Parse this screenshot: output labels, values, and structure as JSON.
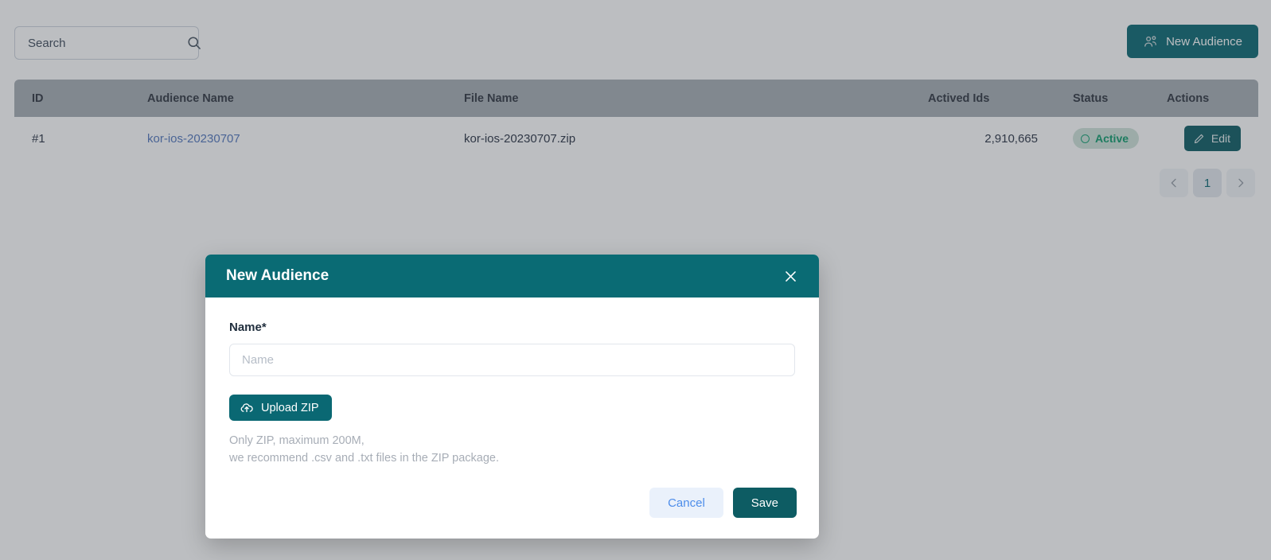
{
  "toolbar": {
    "search_placeholder": "Search",
    "search_value": "",
    "search_icon": "search-icon",
    "new_audience_label": "New Audience",
    "new_audience_icon": "users-group-icon"
  },
  "table": {
    "columns": [
      {
        "key": "id",
        "label": "ID",
        "align": "left"
      },
      {
        "key": "audience_name",
        "label": "Audience Name",
        "align": "left"
      },
      {
        "key": "file_name",
        "label": "File Name",
        "align": "left"
      },
      {
        "key": "actived_ids",
        "label": "Actived Ids",
        "align": "right"
      },
      {
        "key": "status",
        "label": "Status",
        "align": "left"
      },
      {
        "key": "actions",
        "label": "Actions",
        "align": "right"
      }
    ],
    "rows": [
      {
        "id": "#1",
        "audience_name": "kor-ios-20230707",
        "file_name": "kor-ios-20230707.zip",
        "actived_ids": "2,910,665",
        "status": "Active",
        "status_icon": "circle-outline-icon",
        "action_label": "Edit",
        "action_icon": "pencil-icon"
      }
    ]
  },
  "pagination": {
    "prev_icon": "chevron-left-icon",
    "next_icon": "chevron-right-icon",
    "current_page": "1"
  },
  "modal": {
    "title": "New Audience",
    "close_icon": "close-icon",
    "name_label": "Name*",
    "name_placeholder": "Name",
    "name_value": "",
    "upload_label": "Upload ZIP",
    "upload_icon": "cloud-upload-icon",
    "hint_line_1": "Only ZIP, maximum 200M,",
    "hint_line_2": "we recommend .csv and .txt files in the ZIP package.",
    "cancel_label": "Cancel",
    "save_label": "Save"
  },
  "colors": {
    "brand_teal": "#0a6873",
    "header_teal": "#0a6b74",
    "button_dark_teal": "#0d5c63",
    "link_blue": "#5277bd",
    "status_green": "#0f9b6c",
    "status_bg": "#cfe3da",
    "cancel_blue": "#4d8dea",
    "cancel_bg": "#eaf1fb",
    "table_header_bg": "#a6adb4",
    "overlay": "rgba(58,64,72,0.34)"
  }
}
